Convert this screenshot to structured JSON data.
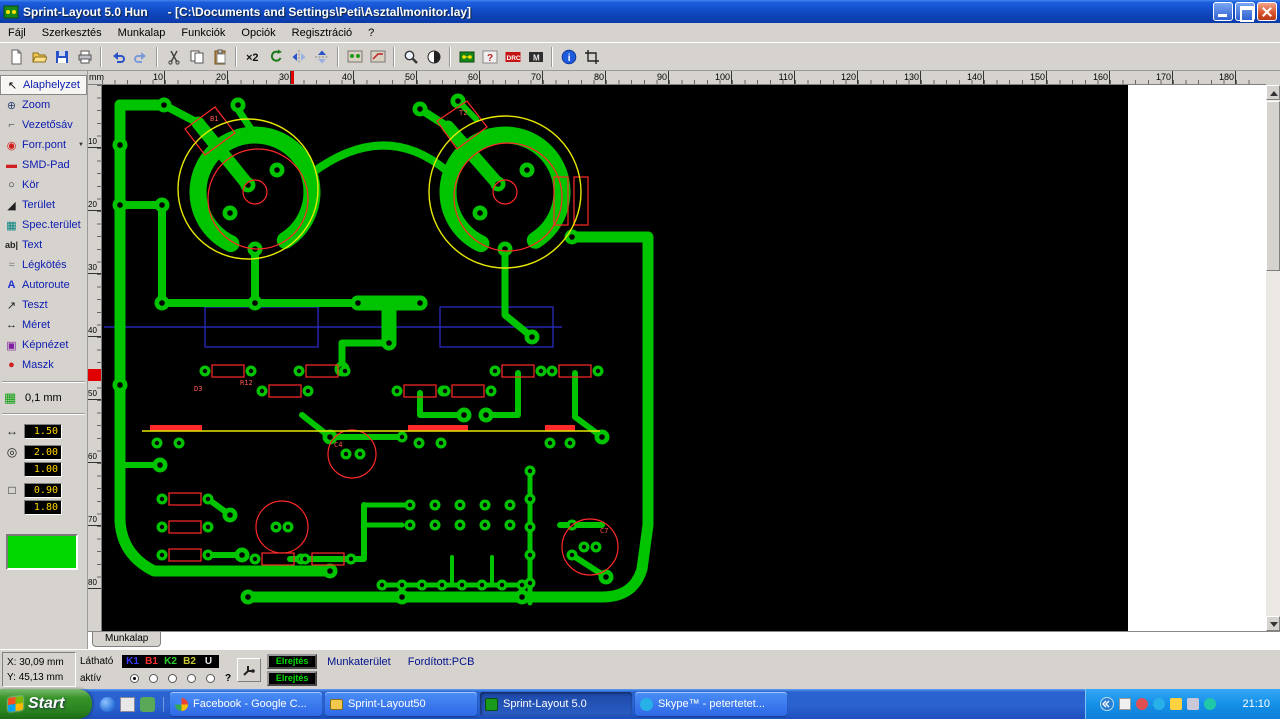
{
  "window": {
    "title": "Sprint-Layout 5.0 Hun      - [C:\\Documents and Settings\\Peti\\Asztal\\monitor.lay]"
  },
  "menu": {
    "items": [
      "Fájl",
      "Szerkesztés",
      "Munkalap",
      "Funkciók",
      "Opciók",
      "Regisztráció",
      "?"
    ]
  },
  "toolbar": {
    "x2_label": "×2",
    "macro_label": "?",
    "drc_label": "DRC",
    "metal_label": "M",
    "info_label": "i"
  },
  "sidebar": {
    "tools": [
      {
        "glyph": "↖",
        "label": "Alaphelyzet",
        "extra": ""
      },
      {
        "glyph": "⊕",
        "label": "Zoom",
        "extra": ""
      },
      {
        "glyph": "⌐",
        "label": "Vezetősáv",
        "extra": ""
      },
      {
        "glyph": "◉",
        "label": "Forr.pont",
        "extra": "▼"
      },
      {
        "glyph": "▬",
        "label": "SMD-Pad",
        "extra": ""
      },
      {
        "glyph": "○",
        "label": "Kör",
        "extra": ""
      },
      {
        "glyph": "◢",
        "label": "Terület",
        "extra": ""
      },
      {
        "glyph": "▦",
        "label": "Spec.terület",
        "extra": ""
      },
      {
        "glyph": "ab|",
        "label": "Text",
        "extra": ""
      },
      {
        "glyph": "≈",
        "label": "Légkötés",
        "extra": ""
      },
      {
        "glyph": "A",
        "label": "Autoroute",
        "extra": ""
      },
      {
        "glyph": "↗",
        "label": "Teszt",
        "extra": ""
      },
      {
        "glyph": "↔",
        "label": "Méret",
        "extra": ""
      },
      {
        "glyph": "▣",
        "label": "Képnézet",
        "extra": ""
      },
      {
        "glyph": "●",
        "label": "Maszk",
        "extra": ""
      }
    ],
    "grid": {
      "glyph": "▦",
      "value": "0,1 mm"
    },
    "param_icons": {
      "track": "↔",
      "pad": "◎",
      "smd": "□"
    },
    "params": {
      "track": "1.50",
      "pad_outer": "2.00",
      "pad_drill": "1.00",
      "smd_w": "0.90",
      "smd_h": "1.80"
    }
  },
  "rulers": {
    "unit": "mm",
    "top": [
      "10",
      "20",
      "30",
      "40",
      "50",
      "60",
      "70",
      "80",
      "90",
      "100",
      "110",
      "120",
      "130",
      "140",
      "150",
      "160",
      "170",
      "180"
    ],
    "left": [
      "10",
      "20",
      "30",
      "40",
      "50",
      "60",
      "70",
      "80"
    ]
  },
  "sheet_tab": {
    "label": "Munkalap"
  },
  "pcb": {
    "labels": [
      "B1",
      "T2",
      "R12",
      "C4",
      "C7",
      "D3"
    ]
  },
  "status": {
    "x_label": "X:",
    "x_value": "30,09 mm",
    "y_label": "Y:",
    "y_value": "45,13 mm",
    "visible_label": "Látható",
    "active_label": "aktív",
    "layers": [
      {
        "label": "K1"
      },
      {
        "label": "B1"
      },
      {
        "label": "K2"
      },
      {
        "label": "B2"
      },
      {
        "label": "U"
      }
    ],
    "help_label": "?",
    "hide_top": "Elrejtés",
    "hide_bottom": "Elrejtés",
    "workspace_label": "Munkaterület",
    "inverted_label": "Fordított:PCB"
  },
  "taskbar": {
    "start_label": "Start",
    "windows": [
      {
        "label": "Facebook - Google C..."
      },
      {
        "label": "Sprint-Layout50"
      },
      {
        "label": "Sprint-Layout 5.0"
      },
      {
        "label": "Skype™ - petertetet..."
      }
    ],
    "clock": "21:10"
  }
}
